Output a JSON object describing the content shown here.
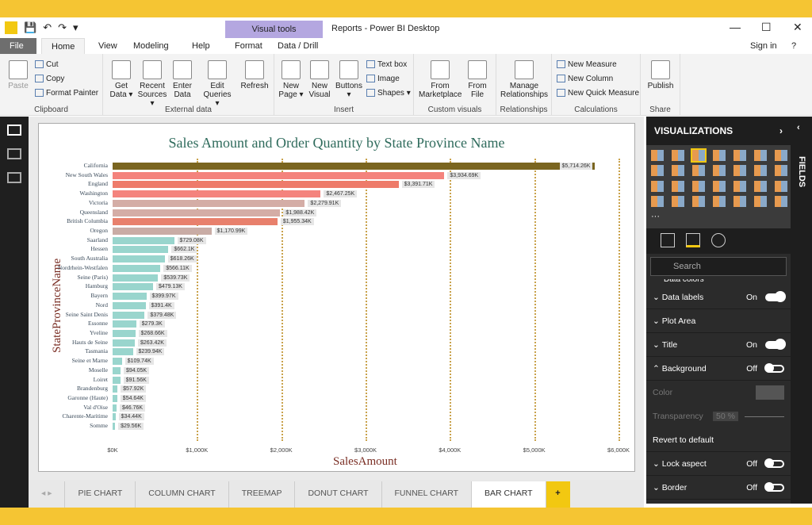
{
  "window": {
    "title": "Reports - Power BI Desktop",
    "context_tab": "Visual tools",
    "sign_in": "Sign in",
    "minimize": "—",
    "maximize": "☐",
    "close": "✕",
    "help": "?"
  },
  "menu_tabs": [
    "File",
    "Home",
    "View",
    "Modeling",
    "Help",
    "Format",
    "Data / Drill"
  ],
  "ribbon": {
    "clipboard": {
      "label": "Clipboard",
      "paste": "Paste",
      "cut": "Cut",
      "copy": "Copy",
      "format_painter": "Format Painter"
    },
    "external": {
      "label": "External data",
      "get_data": "Get Data ▾",
      "recent": "Recent Sources ▾",
      "enter": "Enter Data",
      "edit": "Edit Queries ▾",
      "refresh": "Refresh"
    },
    "insert": {
      "label": "Insert",
      "new_page": "New Page ▾",
      "new_visual": "New Visual",
      "buttons": "Buttons ▾",
      "text_box": "Text box",
      "image": "Image",
      "shapes": "Shapes ▾"
    },
    "custom": {
      "label": "Custom visuals",
      "marketplace": "From Marketplace",
      "file": "From File"
    },
    "relationships": {
      "label": "Relationships",
      "manage": "Manage Relationships"
    },
    "calculations": {
      "label": "Calculations",
      "measure": "New Measure",
      "column": "New Column",
      "quick": "New Quick Measure"
    },
    "share": {
      "label": "Share",
      "publish": "Publish"
    }
  },
  "chart_data": {
    "type": "bar",
    "orientation": "horizontal",
    "title": "Sales Amount and Order Quantity by State Province Name",
    "xlabel": "SalesAmount",
    "ylabel": "StateProvinceName",
    "xlim": [
      0,
      6000
    ],
    "x_ticks": [
      "$0K",
      "$1,000K",
      "$2,000K",
      "$3,000K",
      "$4,000K",
      "$5,000K",
      "$6,000K"
    ],
    "grid": true,
    "categories": [
      "California",
      "New South Wales",
      "England",
      "Washington",
      "Victoria",
      "Queensland",
      "British Columbia",
      "Oregon",
      "Saarland",
      "Hessen",
      "South Australia",
      "Nordrhein-Westfalen",
      "Seine (Paris)",
      "Hamburg",
      "Bayern",
      "Nord",
      "Seine Saint Denis",
      "Essonne",
      "Yveline",
      "Hauts de Seine",
      "Tasmania",
      "Seine et Marne",
      "Moselle",
      "Loiret",
      "Brandenburg",
      "Garonne (Haute)",
      "Val d'Oise",
      "Charente-Maritime",
      "Somme"
    ],
    "values": [
      5714.26,
      3934.69,
      3391.71,
      2467.25,
      2279.91,
      1988.42,
      1955.34,
      1170.99,
      729.08,
      662.1,
      618.26,
      566.11,
      539.73,
      479.13,
      399.97,
      391.4,
      379.48,
      279.3,
      268.66,
      263.42,
      239.94,
      109.74,
      94.05,
      91.56,
      57.92,
      54.64,
      46.76,
      34.44,
      29.56
    ],
    "labels": [
      "$5,714.26K",
      "$3,934.69K",
      "$3,391.71K",
      "$2,467.25K",
      "$2,279.91K",
      "$1,988.42K",
      "$1,955.34K",
      "$1,170.99K",
      "$729.08K",
      "$662.1K",
      "$618.26K",
      "$566.11K",
      "$539.73K",
      "$479.13K",
      "$399.97K",
      "$391.4K",
      "$379.48K",
      "$279.3K",
      "$268.66K",
      "$263.42K",
      "$239.94K",
      "$109.74K",
      "$94.05K",
      "$91.56K",
      "$57.92K",
      "$54.64K",
      "$46.76K",
      "$34.44K",
      "$29.56K"
    ],
    "colors": [
      "#7a6520",
      "#f4837d",
      "#ee7b6a",
      "#f4837d",
      "#d4ada6",
      "#d4ada6",
      "#e8806c",
      "#c9aca5",
      "#99d5cd"
    ]
  },
  "viz_pane": {
    "title": "VISUALIZATIONS",
    "search_placeholder": "Search",
    "cut_row": "Data colors",
    "rows": [
      {
        "name": "Data labels",
        "value": "On",
        "on": true
      },
      {
        "name": "Plot Area"
      },
      {
        "name": "Title",
        "value": "On",
        "on": true
      },
      {
        "name": "Background",
        "value": "Off",
        "on": false,
        "expanded": true
      }
    ],
    "color_label": "Color",
    "transparency_label": "Transparency",
    "transparency_value": "50",
    "transparency_unit": "%",
    "revert": "Revert to default",
    "rows2": [
      {
        "name": "Lock aspect",
        "value": "Off"
      },
      {
        "name": "Border",
        "value": "Off"
      }
    ]
  },
  "fields_pane": {
    "title": "FIELDS"
  },
  "pages": [
    "PIE CHART",
    "COLUMN CHART",
    "TREEMAP",
    "DONUT CHART",
    "FUNNEL CHART",
    "BAR CHART"
  ],
  "active_page": "BAR CHART",
  "add_page": "+"
}
